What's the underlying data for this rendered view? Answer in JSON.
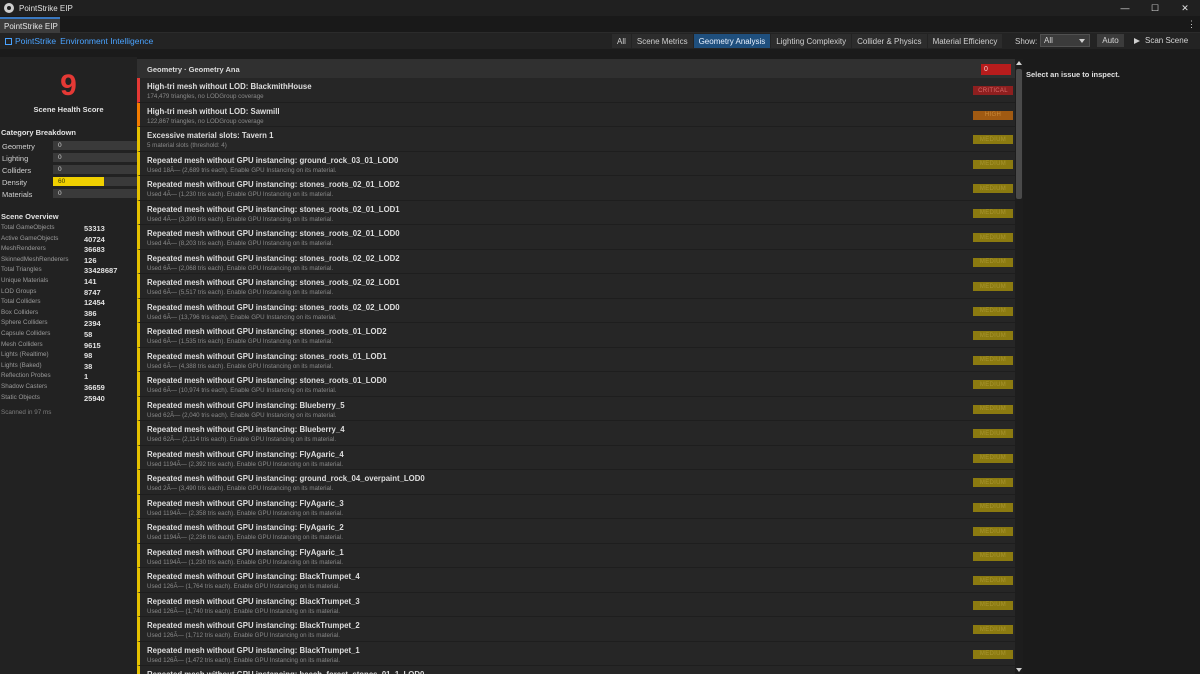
{
  "window": {
    "title": "PointStrike EIP",
    "min": "—",
    "max": "☐",
    "close": "✕"
  },
  "tab": {
    "label": "PointStrike EIP",
    "menu": "⋮"
  },
  "toolbar": {
    "brand_a": "PointStrike",
    "brand_b": "Environment Intelligence",
    "tabs": [
      "All",
      "Scene Metrics",
      "Geometry Analysis",
      "Lighting Complexity",
      "Collider & Physics",
      "Material Efficiency"
    ],
    "active_tab": "Geometry Analysis",
    "show_label": "Show:",
    "show_value": "All",
    "auto_label": "Auto",
    "scan_label": "Scan Scene"
  },
  "sidebar": {
    "score": "9",
    "score_label": "Scene Health Score",
    "category_title": "Category Breakdown",
    "categories": [
      {
        "name": "Geometry",
        "value": "0",
        "fraction": 0
      },
      {
        "name": "Lighting",
        "value": "0",
        "fraction": 0
      },
      {
        "name": "Colliders",
        "value": "0",
        "fraction": 0
      },
      {
        "name": "Density",
        "value": "60",
        "fraction": 0.6
      },
      {
        "name": "Materials",
        "value": "0",
        "fraction": 0
      }
    ],
    "overview_title": "Scene Overview",
    "overview": [
      {
        "k": "Total GameObjects",
        "v": "53313"
      },
      {
        "k": "Active GameObjects",
        "v": "40724"
      },
      {
        "k": "MeshRenderers",
        "v": "36683"
      },
      {
        "k": "SkinnedMeshRenderers",
        "v": "126"
      },
      {
        "k": "Total Triangles",
        "v": "33428687"
      },
      {
        "k": "Unique Materials",
        "v": "141"
      },
      {
        "k": "LOD Groups",
        "v": "8747"
      },
      {
        "k": "Total Colliders",
        "v": "12454"
      },
      {
        "k": "Box Colliders",
        "v": "386"
      },
      {
        "k": "Sphere Colliders",
        "v": "2394"
      },
      {
        "k": "Capsule Colliders",
        "v": "58"
      },
      {
        "k": "Mesh Colliders",
        "v": "9615"
      },
      {
        "k": "Lights (Realtime)",
        "v": "98"
      },
      {
        "k": "Lights (Baked)",
        "v": "38"
      },
      {
        "k": "Reflection Probes",
        "v": "1"
      },
      {
        "k": "Shadow Casters",
        "v": "36659"
      },
      {
        "k": "Static Objects",
        "v": "25940"
      }
    ],
    "scanned": "Scanned in 97 ms"
  },
  "list": {
    "crumb": "Geometry  ·  Geometry Ana",
    "count": "0",
    "issues": [
      {
        "title": "High-tri mesh without LOD: BlackmithHouse",
        "sub": "174,479 triangles, no LODGroup coverage",
        "severity": "CRITICAL",
        "bar": "#e53935",
        "badge_bg": "#8e1f1f",
        "badge_fg": "#d86a6a"
      },
      {
        "title": "High-tri mesh without LOD: Sawmill",
        "sub": "122,867 triangles, no LODGroup coverage",
        "severity": "HIGH",
        "bar": "#f57c00",
        "badge_bg": "#a05a12",
        "badge_fg": "#c98a3a"
      },
      {
        "title": "Excessive material slots: Tavern 1",
        "sub": "5 material slots (threshold: 4)",
        "severity": "MEDIUM",
        "bar": "#e6c200",
        "badge_bg": "#8b7a10",
        "badge_fg": "#a89530"
      },
      {
        "title": "Repeated mesh without GPU instancing: ground_rock_03_01_LOD0",
        "sub": "Used 18Ã— (2,689 tris each). Enable GPU Instancing on its material.",
        "severity": "MEDIUM",
        "bar": "#e6c200",
        "badge_bg": "#8b7a10",
        "badge_fg": "#a89530"
      },
      {
        "title": "Repeated mesh without GPU instancing: stones_roots_02_01_LOD2",
        "sub": "Used 4Ã— (1,230 tris each). Enable GPU Instancing on its material.",
        "severity": "MEDIUM",
        "bar": "#e6c200",
        "badge_bg": "#8b7a10",
        "badge_fg": "#a89530"
      },
      {
        "title": "Repeated mesh without GPU instancing: stones_roots_02_01_LOD1",
        "sub": "Used 4Ã— (3,390 tris each). Enable GPU Instancing on its material.",
        "severity": "MEDIUM",
        "bar": "#e6c200",
        "badge_bg": "#8b7a10",
        "badge_fg": "#a89530"
      },
      {
        "title": "Repeated mesh without GPU instancing: stones_roots_02_01_LOD0",
        "sub": "Used 4Ã— (8,203 tris each). Enable GPU Instancing on its material.",
        "severity": "MEDIUM",
        "bar": "#e6c200",
        "badge_bg": "#8b7a10",
        "badge_fg": "#a89530"
      },
      {
        "title": "Repeated mesh without GPU instancing: stones_roots_02_02_LOD2",
        "sub": "Used 6Ã— (2,068 tris each). Enable GPU Instancing on its material.",
        "severity": "MEDIUM",
        "bar": "#e6c200",
        "badge_bg": "#8b7a10",
        "badge_fg": "#a89530"
      },
      {
        "title": "Repeated mesh without GPU instancing: stones_roots_02_02_LOD1",
        "sub": "Used 6Ã— (5,517 tris each). Enable GPU Instancing on its material.",
        "severity": "MEDIUM",
        "bar": "#e6c200",
        "badge_bg": "#8b7a10",
        "badge_fg": "#a89530"
      },
      {
        "title": "Repeated mesh without GPU instancing: stones_roots_02_02_LOD0",
        "sub": "Used 6Ã— (13,796 tris each). Enable GPU Instancing on its material.",
        "severity": "MEDIUM",
        "bar": "#e6c200",
        "badge_bg": "#8b7a10",
        "badge_fg": "#a89530"
      },
      {
        "title": "Repeated mesh without GPU instancing: stones_roots_01_LOD2",
        "sub": "Used 6Ã— (1,535 tris each). Enable GPU Instancing on its material.",
        "severity": "MEDIUM",
        "bar": "#e6c200",
        "badge_bg": "#8b7a10",
        "badge_fg": "#a89530"
      },
      {
        "title": "Repeated mesh without GPU instancing: stones_roots_01_LOD1",
        "sub": "Used 6Ã— (4,388 tris each). Enable GPU Instancing on its material.",
        "severity": "MEDIUM",
        "bar": "#e6c200",
        "badge_bg": "#8b7a10",
        "badge_fg": "#a89530"
      },
      {
        "title": "Repeated mesh without GPU instancing: stones_roots_01_LOD0",
        "sub": "Used 6Ã— (10,974 tris each). Enable GPU Instancing on its material.",
        "severity": "MEDIUM",
        "bar": "#e6c200",
        "badge_bg": "#8b7a10",
        "badge_fg": "#a89530"
      },
      {
        "title": "Repeated mesh without GPU instancing: Blueberry_5",
        "sub": "Used 62Ã— (2,040 tris each). Enable GPU Instancing on its material.",
        "severity": "MEDIUM",
        "bar": "#e6c200",
        "badge_bg": "#8b7a10",
        "badge_fg": "#a89530"
      },
      {
        "title": "Repeated mesh without GPU instancing: Blueberry_4",
        "sub": "Used 62Ã— (2,114 tris each). Enable GPU Instancing on its material.",
        "severity": "MEDIUM",
        "bar": "#e6c200",
        "badge_bg": "#8b7a10",
        "badge_fg": "#a89530"
      },
      {
        "title": "Repeated mesh without GPU instancing: FlyAgaric_4",
        "sub": "Used 1194Ã— (2,392 tris each). Enable GPU Instancing on its material.",
        "severity": "MEDIUM",
        "bar": "#e6c200",
        "badge_bg": "#8b7a10",
        "badge_fg": "#a89530"
      },
      {
        "title": "Repeated mesh without GPU instancing: ground_rock_04_overpaint_LOD0",
        "sub": "Used 2Ã— (3,490 tris each). Enable GPU Instancing on its material.",
        "severity": "MEDIUM",
        "bar": "#e6c200",
        "badge_bg": "#8b7a10",
        "badge_fg": "#a89530"
      },
      {
        "title": "Repeated mesh without GPU instancing: FlyAgaric_3",
        "sub": "Used 1194Ã— (2,358 tris each). Enable GPU Instancing on its material.",
        "severity": "MEDIUM",
        "bar": "#e6c200",
        "badge_bg": "#8b7a10",
        "badge_fg": "#a89530"
      },
      {
        "title": "Repeated mesh without GPU instancing: FlyAgaric_2",
        "sub": "Used 1194Ã— (2,236 tris each). Enable GPU Instancing on its material.",
        "severity": "MEDIUM",
        "bar": "#e6c200",
        "badge_bg": "#8b7a10",
        "badge_fg": "#a89530"
      },
      {
        "title": "Repeated mesh without GPU instancing: FlyAgaric_1",
        "sub": "Used 1194Ã— (1,230 tris each). Enable GPU Instancing on its material.",
        "severity": "MEDIUM",
        "bar": "#e6c200",
        "badge_bg": "#8b7a10",
        "badge_fg": "#a89530"
      },
      {
        "title": "Repeated mesh without GPU instancing: BlackTrumpet_4",
        "sub": "Used 126Ã— (1,764 tris each). Enable GPU Instancing on its material.",
        "severity": "MEDIUM",
        "bar": "#e6c200",
        "badge_bg": "#8b7a10",
        "badge_fg": "#a89530"
      },
      {
        "title": "Repeated mesh without GPU instancing: BlackTrumpet_3",
        "sub": "Used 126Ã— (1,740 tris each). Enable GPU Instancing on its material.",
        "severity": "MEDIUM",
        "bar": "#e6c200",
        "badge_bg": "#8b7a10",
        "badge_fg": "#a89530"
      },
      {
        "title": "Repeated mesh without GPU instancing: BlackTrumpet_2",
        "sub": "Used 126Ã— (1,712 tris each). Enable GPU Instancing on its material.",
        "severity": "MEDIUM",
        "bar": "#e6c200",
        "badge_bg": "#8b7a10",
        "badge_fg": "#a89530"
      },
      {
        "title": "Repeated mesh without GPU instancing: BlackTrumpet_1",
        "sub": "Used 126Ã— (1,472 tris each). Enable GPU Instancing on its material.",
        "severity": "MEDIUM",
        "bar": "#e6c200",
        "badge_bg": "#8b7a10",
        "badge_fg": "#a89530"
      },
      {
        "title": "Repeated mesh without GPU instancing: beech_forest_stones_01_1_LOD0",
        "sub": "",
        "severity": "MEDIUM",
        "bar": "#e6c200",
        "badge_bg": "#8b7a10",
        "badge_fg": "#a89530"
      }
    ]
  },
  "inspector": {
    "hint": "Select an issue to inspect."
  }
}
